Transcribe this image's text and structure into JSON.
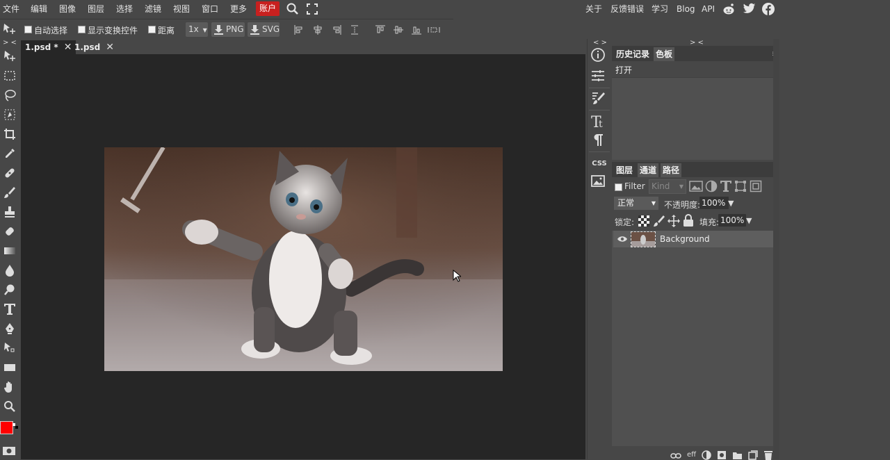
{
  "menu": {
    "items": [
      "文件",
      "编辑",
      "图像",
      "图层",
      "选择",
      "滤镜",
      "视图",
      "窗口",
      "更多"
    ],
    "account": "账户",
    "right": [
      "关于",
      "反馈错误",
      "学习",
      "Blog",
      "API"
    ]
  },
  "options": {
    "auto_select": "自动选择",
    "show_transform": "显示变换控件",
    "distance": "距离",
    "zoom": "1x",
    "png": "PNG",
    "svg": "SVG"
  },
  "tabs": [
    {
      "label": "1.psd *",
      "close": "✕"
    },
    {
      "label": "1.psd",
      "close": "✕"
    }
  ],
  "collapse": {
    "left": "> <",
    "mid": "< >",
    "right": "> <"
  },
  "history_panel": {
    "tabs": [
      "历史记录",
      "色板"
    ],
    "items": [
      "打开"
    ],
    "menu": "≡"
  },
  "layers_panel": {
    "tabs": [
      "图层",
      "通道",
      "路径"
    ],
    "filter_label": "Filter",
    "kind": "Kind",
    "blend_mode": "正常",
    "opacity_label": "不透明度:",
    "opacity_value": "100%",
    "lock_label": "锁定:",
    "fill_label": "填充:",
    "fill_value": "100%",
    "layers": [
      {
        "name": "Background",
        "visible": true
      }
    ],
    "bottom_eff": "eff"
  },
  "right_icons": {
    "css": "CSS"
  },
  "colors": {
    "accent_red": "#c8201f",
    "foreground": "#ff0000",
    "background": "#000000",
    "workspace": "#262626",
    "chrome": "#474747"
  }
}
